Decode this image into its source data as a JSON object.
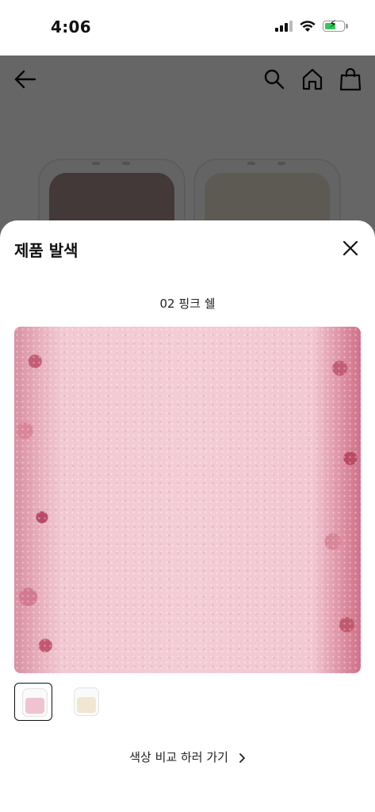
{
  "status_bar": {
    "time": "4:06",
    "icons": [
      "cellular-signal-icon",
      "wifi-icon",
      "battery-charging-icon"
    ],
    "battery_color": "#34c759"
  },
  "background_page": {
    "header_icons": [
      "back-arrow-icon",
      "search-icon",
      "home-icon",
      "shopping-bag-icon"
    ],
    "product_compacts": [
      {
        "pan_color": "#a58e8c"
      },
      {
        "pan_color": "#e6e1cf"
      }
    ]
  },
  "sheet": {
    "title": "제품 발색",
    "close_icon": "close-icon",
    "shade_name": "02 핑크 쉘",
    "swatch_color": "#f3ccd5",
    "thumbnails": [
      {
        "color": "#efc4d0",
        "selected": true
      },
      {
        "color": "#f0e6d4",
        "selected": false
      }
    ],
    "compare_link": "색상 비교 하러 가기",
    "compare_icon": "chevron-right-icon"
  }
}
